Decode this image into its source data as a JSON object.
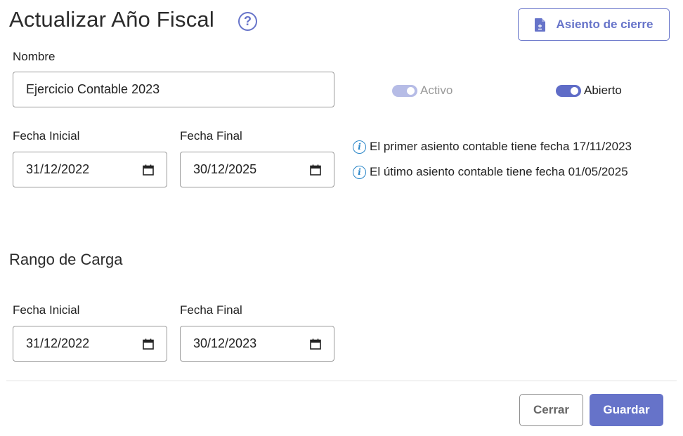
{
  "header": {
    "title": "Actualizar Año Fiscal",
    "help_icon": "?",
    "closing_entry_button": "Asiento de cierre"
  },
  "form": {
    "name_label": "Nombre",
    "name_value": "Ejercicio Contable 2023",
    "toggles": {
      "active_label": "Activo",
      "active_on": true,
      "active_disabled": true,
      "open_label": "Abierto",
      "open_on": true
    },
    "fiscal_dates": {
      "start_label": "Fecha Inicial",
      "start_value": "31/12/2022",
      "end_label": "Fecha Final",
      "end_value": "30/12/2025"
    },
    "info": {
      "first_entry": "El primer asiento contable tiene fecha 17/11/2023",
      "last_entry": "El útimo asiento contable tiene fecha 01/05/2025"
    },
    "load_range": {
      "title": "Rango de Carga",
      "start_label": "Fecha Inicial",
      "start_value": "31/12/2022",
      "end_label": "Fecha Final",
      "end_value": "30/12/2023"
    }
  },
  "footer": {
    "cancel_label": "Cerrar",
    "save_label": "Guardar"
  },
  "colors": {
    "primary": "#6673c9",
    "info": "#2a86c8",
    "toggle_disabled": "#b6bce6"
  }
}
